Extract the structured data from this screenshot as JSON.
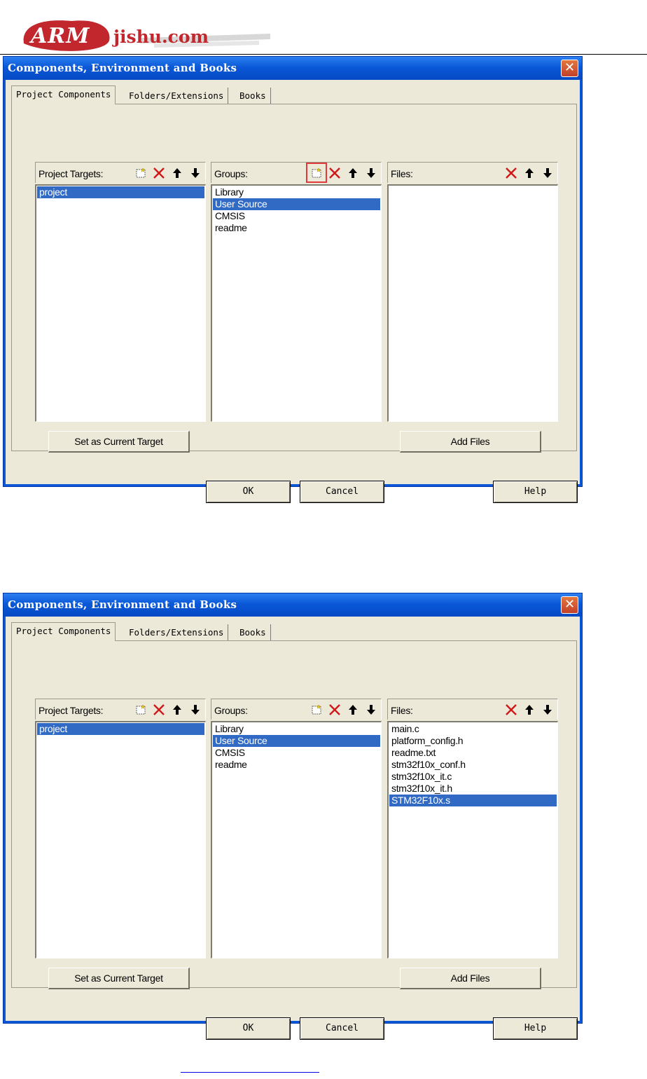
{
  "header": {
    "logo_part1": "ARM",
    "logo_part2": "jishu.com"
  },
  "dialogs": [
    {
      "title": "Components, Environment and Books",
      "close_glyph": "✕",
      "tabs": [
        "Project Components",
        "Folders/Extensions",
        "Books"
      ],
      "targets": {
        "label": "Project Targets:",
        "items": [
          "project"
        ],
        "selected": 0
      },
      "groups": {
        "label": "Groups:",
        "items": [
          "Library",
          "User Source",
          "CMSIS",
          "readme"
        ],
        "selected": 1,
        "highlighted_tool": "new-group"
      },
      "files": {
        "label": "Files:",
        "items": [],
        "selected": -1
      },
      "set_target_label": "Set as Current Target",
      "add_files_label": "Add Files",
      "ok_label": "OK",
      "cancel_label": "Cancel",
      "help_label": "Help"
    },
    {
      "title": "Components, Environment and Books",
      "close_glyph": "✕",
      "tabs": [
        "Project Components",
        "Folders/Extensions",
        "Books"
      ],
      "targets": {
        "label": "Project Targets:",
        "items": [
          "project"
        ],
        "selected": 0
      },
      "groups": {
        "label": "Groups:",
        "items": [
          "Library",
          "User Source",
          "CMSIS",
          "readme"
        ],
        "selected": 1,
        "highlighted_tool": ""
      },
      "files": {
        "label": "Files:",
        "items": [
          "main.c",
          "platform_config.h",
          "readme.txt",
          "stm32f10x_conf.h",
          "stm32f10x_it.c",
          "stm32f10x_it.h",
          "STM32F10x.s"
        ],
        "selected": 6
      },
      "set_target_label": "Set as Current Target",
      "add_files_label": "Add Files",
      "ok_label": "OK",
      "cancel_label": "Cancel",
      "help_label": "Help"
    }
  ],
  "icons": {
    "new": "new-item-icon",
    "delete": "delete-icon",
    "up": "move-up-icon",
    "down": "move-down-icon"
  },
  "colors": {
    "titlebar": "#0a58d8",
    "selection": "#316ac5",
    "dialog_bg": "#ece9d8",
    "highlight_box": "#e23a3a",
    "logo_red": "#c1272d"
  }
}
